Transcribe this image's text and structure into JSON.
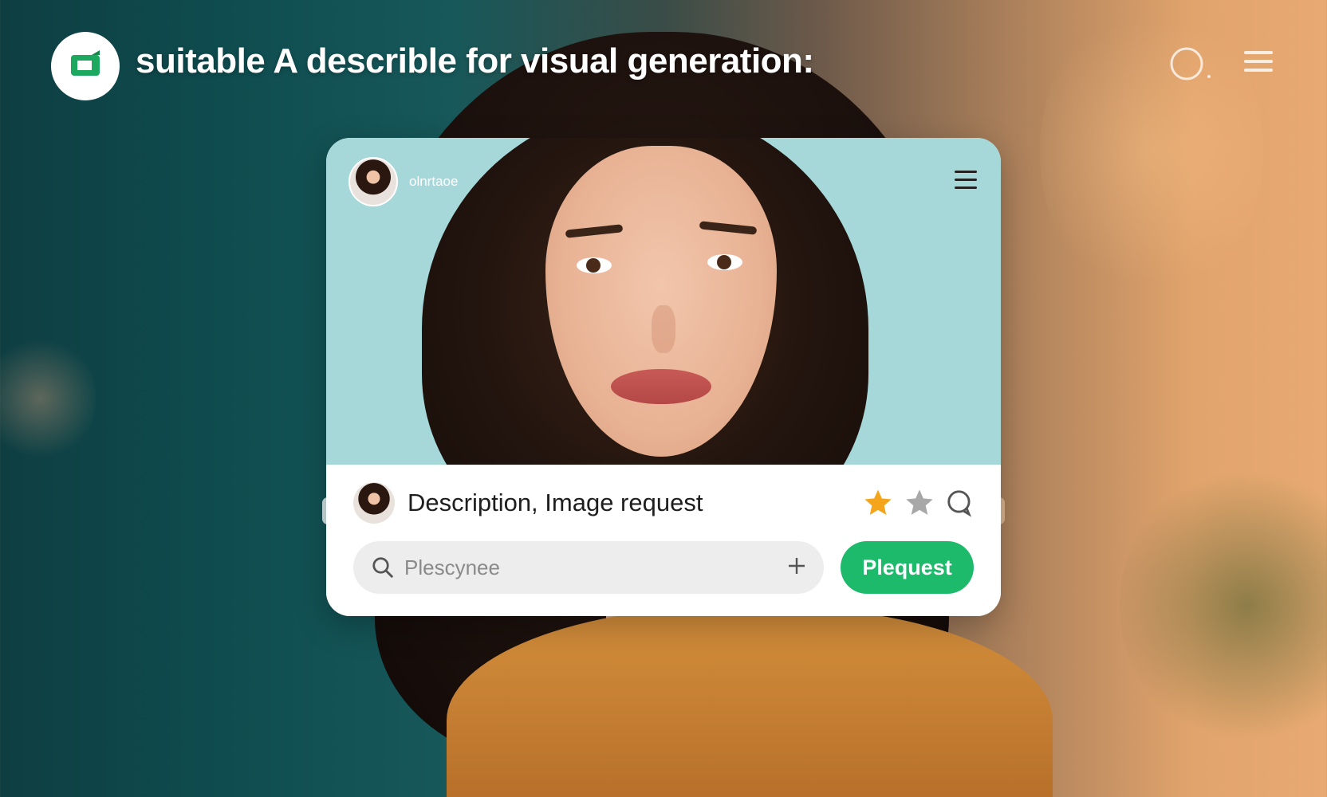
{
  "header": {
    "title": "suitable A describle for visual generation:",
    "logo_icon": "video-call-logo-icon",
    "right_icons": [
      "search-icon",
      "menu-icon"
    ]
  },
  "card": {
    "profile": {
      "name": "olnrtaoe"
    },
    "menu_icon": "menu-icon",
    "request": {
      "title": "Description, Image request",
      "icons": [
        "star-filled-icon",
        "star-empty-icon",
        "comment-icon"
      ]
    },
    "search": {
      "placeholder": "Plescynee",
      "value": ""
    },
    "button_label": "Plequest"
  },
  "colors": {
    "accent": "#1dba6b",
    "star": "#f4a51c",
    "card_photo_bg": "#a6d8da"
  }
}
